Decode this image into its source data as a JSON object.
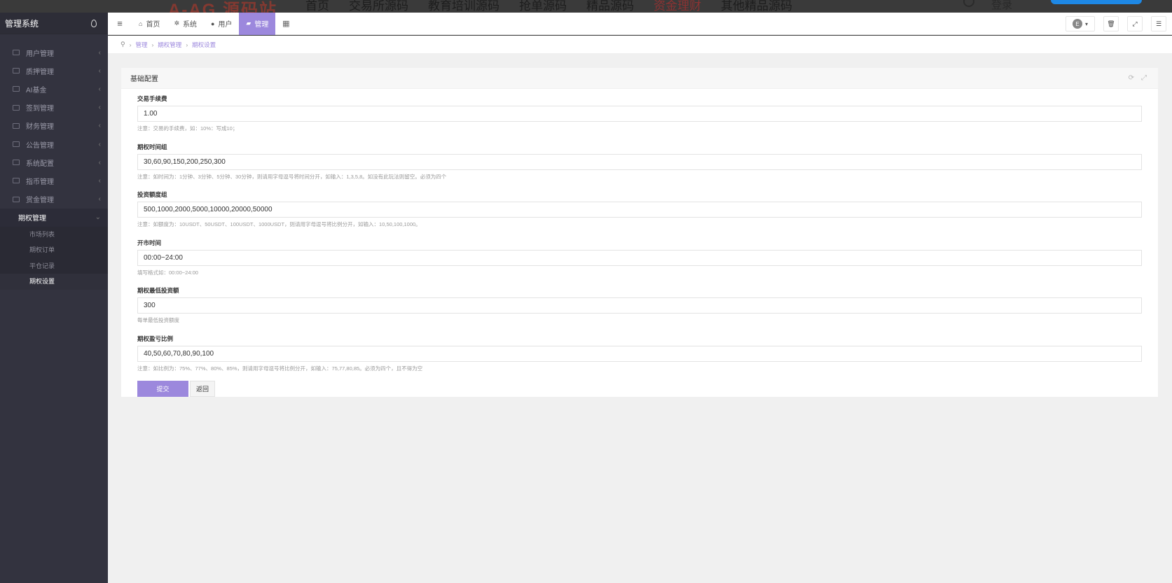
{
  "background_site": {
    "logo": "A-AG 源码站",
    "nav": [
      "首页",
      "交易所源码",
      "教育培训源码",
      "抢单源码",
      "精品源码",
      "资金理财",
      "其他精品源码"
    ],
    "login": "登录"
  },
  "sidebar": {
    "title": "管理系统",
    "items": [
      {
        "label": "用户管理",
        "icon": "user-icon"
      },
      {
        "label": "质押管理",
        "icon": "list-icon"
      },
      {
        "label": "AI基金",
        "icon": "monitor-icon"
      },
      {
        "label": "签到管理",
        "icon": "edit-icon"
      },
      {
        "label": "财务管理",
        "icon": "money-icon"
      },
      {
        "label": "公告管理",
        "icon": "list-icon"
      },
      {
        "label": "系统配置",
        "icon": "cogs-icon"
      },
      {
        "label": "指币管理",
        "icon": "coin-icon"
      },
      {
        "label": "赏金管理",
        "icon": "gift-icon"
      },
      {
        "label": "期权管理",
        "icon": "options-icon"
      }
    ],
    "submenu": [
      "市场列表",
      "期权订单",
      "平仓记录",
      "期权设置"
    ]
  },
  "topbar": {
    "tabs": [
      {
        "label": "首页",
        "icon": "home-icon"
      },
      {
        "label": "系统",
        "icon": "gear-icon"
      },
      {
        "label": "用户",
        "icon": "user-icon"
      },
      {
        "label": "管理",
        "icon": "briefcase-icon"
      }
    ],
    "lang": "E"
  },
  "breadcrumb": [
    "管理",
    "期权管理",
    "期权设置"
  ],
  "panel": {
    "title": "基础配置",
    "fields": [
      {
        "label": "交易手续费",
        "value": "1.00",
        "hint": "注意：交易的手续费，如：10%：写成10；"
      },
      {
        "label": "期权时间组",
        "value": "30,60,90,150,200,250,300",
        "hint": "注意：如时间为：1分钟、3分钟、5分钟、30分钟，则请用字母逗号将时间分开，如输入：1,3,5,8。如没有此玩法则留空。必须为四个"
      },
      {
        "label": "投资额度组",
        "value": "500,1000,2000,5000,10000,20000,50000",
        "hint": "注意：如额度为：10USDT、50USDT、100USDT、1000USDT，则请用字母逗号将比例分开，如输入：10,50,100,1000。"
      },
      {
        "label": "开市时间",
        "value": "00:00~24:00",
        "hint": "填写格式如：00:00~24:00"
      },
      {
        "label": "期权最低投资额",
        "value": "300",
        "hint": "每单最低投资额度"
      },
      {
        "label": "期权盈亏比例",
        "value": "40,50,60,70,80,90,100",
        "hint": "注意：如比例为：75%、77%、80%、85%，则请用字母逗号将比例分开，如输入：75,77,80,85。必须为四个，且不得为空"
      }
    ],
    "submit": "提交",
    "back": "返回"
  },
  "colors": {
    "accent": "#9c88dd",
    "sidebar": "#33333f",
    "content_bg": "#f0f0f0"
  }
}
